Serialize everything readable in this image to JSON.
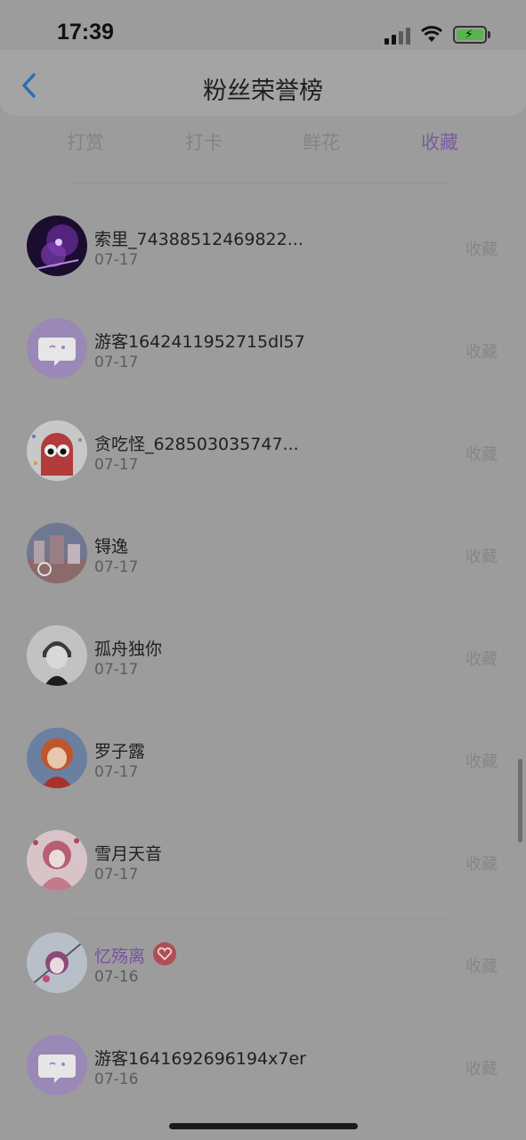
{
  "status_bar": {
    "time": "17:39"
  },
  "header": {
    "title": "粉丝荣誉榜"
  },
  "tabs": [
    {
      "label": "打赏",
      "active": false
    },
    {
      "label": "打卡",
      "active": false
    },
    {
      "label": "鲜花",
      "active": false
    },
    {
      "label": "收藏",
      "active": true
    }
  ],
  "list": [
    {
      "name": "索里_74388512469822...",
      "date": "07-17",
      "action": "收藏",
      "avatar": "galaxy-avatar"
    },
    {
      "name": "游客1642411952715dl57",
      "date": "07-17",
      "action": "收藏",
      "avatar": "default-chat-avatar"
    },
    {
      "name": "贪吃怪_628503035747...",
      "date": "07-17",
      "action": "收藏",
      "avatar": "red-monster-avatar"
    },
    {
      "name": "锝逸",
      "date": "07-17",
      "action": "收藏",
      "avatar": "city-photo-avatar"
    },
    {
      "name": "孤舟独你",
      "date": "07-17",
      "action": "收藏",
      "avatar": "sketch-boy-avatar"
    },
    {
      "name": "罗子露",
      "date": "07-17",
      "action": "收藏",
      "avatar": "anime-redhair-avatar"
    },
    {
      "name": "雪月天音",
      "date": "07-17",
      "action": "收藏",
      "avatar": "pink-anime-avatar"
    },
    {
      "name": "忆殇离",
      "date": "07-16",
      "action": "收藏",
      "avatar": "anime-girl-avatar",
      "vip": true
    },
    {
      "name": "游客1641692696194x7er",
      "date": "07-16",
      "action": "收藏",
      "avatar": "default-chat-avatar"
    }
  ],
  "colors": {
    "accent": "#7a5ca0",
    "vip_badge": "#b04e57",
    "overlay_bg": "#9c9c9c"
  }
}
